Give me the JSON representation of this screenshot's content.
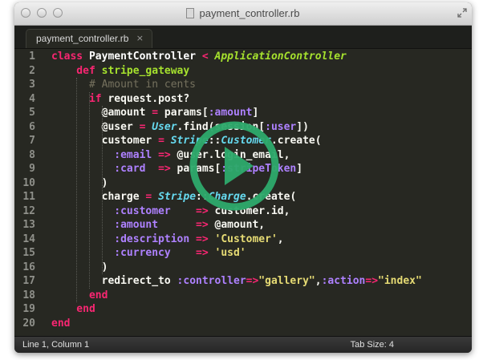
{
  "window": {
    "title": "payment_controller.rb",
    "tab_label": "payment_controller.rb",
    "tab_close": "×"
  },
  "status": {
    "position": "Line 1, Column 1",
    "tab_size": "Tab Size: 4"
  },
  "line_numbers": [
    "1",
    "2",
    "3",
    "4",
    "5",
    "6",
    "7",
    "8",
    "9",
    "10",
    "11",
    "12",
    "13",
    "14",
    "15",
    "16",
    "17",
    "18",
    "19",
    "20"
  ],
  "code": [
    [
      [
        "kw",
        "class "
      ],
      [
        "cls",
        "PaymentController "
      ],
      [
        "op",
        "< "
      ],
      [
        "inh",
        "ApplicationController"
      ]
    ],
    [
      [
        "kw",
        "    def "
      ],
      [
        "fn",
        "stripe_gateway"
      ]
    ],
    [
      [
        "cm",
        "      # Amount in cents"
      ]
    ],
    [
      [
        "kw",
        "      if "
      ],
      [
        "iv",
        "request.post?"
      ]
    ],
    [
      [
        "iv",
        "        @amount "
      ],
      [
        "op",
        "= "
      ],
      [
        "iv",
        "params["
      ],
      [
        "sym",
        ":amount"
      ],
      [
        "iv",
        "]"
      ]
    ],
    [
      [
        "iv",
        "        @user "
      ],
      [
        "op",
        "= "
      ],
      [
        "typ",
        "User"
      ],
      [
        "iv",
        ".find(session["
      ],
      [
        "sym",
        ":user"
      ],
      [
        "iv",
        "])"
      ]
    ],
    [
      [
        "iv",
        "        customer "
      ],
      [
        "op",
        "= "
      ],
      [
        "typ",
        "Stripe"
      ],
      [
        "iv",
        "::"
      ],
      [
        "typ",
        "Customer"
      ],
      [
        "iv",
        ".create("
      ]
    ],
    [
      [
        "sym",
        "          :email "
      ],
      [
        "op",
        "=> "
      ],
      [
        "iv",
        "@user.login_email,"
      ]
    ],
    [
      [
        "sym",
        "          :card  "
      ],
      [
        "op",
        "=> "
      ],
      [
        "iv",
        "params["
      ],
      [
        "sym",
        ":stripeToken"
      ],
      [
        "iv",
        "]"
      ]
    ],
    [
      [
        "iv",
        "        )"
      ]
    ],
    [
      [
        "iv",
        "        charge "
      ],
      [
        "op",
        "= "
      ],
      [
        "typ",
        "Stripe"
      ],
      [
        "iv",
        "::"
      ],
      [
        "typ",
        "Charge"
      ],
      [
        "iv",
        ".create("
      ]
    ],
    [
      [
        "sym",
        "          :customer    "
      ],
      [
        "op",
        "=> "
      ],
      [
        "iv",
        "customer.id,"
      ]
    ],
    [
      [
        "sym",
        "          :amount      "
      ],
      [
        "op",
        "=> "
      ],
      [
        "iv",
        "@amount,"
      ]
    ],
    [
      [
        "sym",
        "          :description "
      ],
      [
        "op",
        "=> "
      ],
      [
        "str",
        "'Customer'"
      ],
      [
        "iv",
        ","
      ]
    ],
    [
      [
        "sym",
        "          :currency    "
      ],
      [
        "op",
        "=> "
      ],
      [
        "str",
        "'usd'"
      ]
    ],
    [
      [
        "iv",
        "        )"
      ]
    ],
    [
      [
        "iv",
        "        redirect_to "
      ],
      [
        "sym",
        ":controller"
      ],
      [
        "op",
        "=>"
      ],
      [
        "str",
        "\"gallery\""
      ],
      [
        "iv",
        ","
      ],
      [
        "sym",
        ":action"
      ],
      [
        "op",
        "=>"
      ],
      [
        "str",
        "\"index\""
      ]
    ],
    [
      [
        "kw",
        "      end"
      ]
    ],
    [
      [
        "kw",
        "    end"
      ]
    ],
    [
      [
        "kw",
        "end"
      ]
    ]
  ],
  "colors": {
    "editor_bg": "#272822",
    "keyword": "#f92672",
    "function": "#a6e22e",
    "symbol": "#ae81ff",
    "string": "#e6db74",
    "type": "#66d9ef",
    "comment": "#75715e",
    "play_overlay": "#2ea96b"
  },
  "icons": {
    "close": "traffic-close-icon",
    "minimize": "traffic-minimize-icon",
    "maximize": "traffic-maximize-icon",
    "fullscreen": "fullscreen-icon",
    "file": "file-icon",
    "play": "play-icon"
  }
}
